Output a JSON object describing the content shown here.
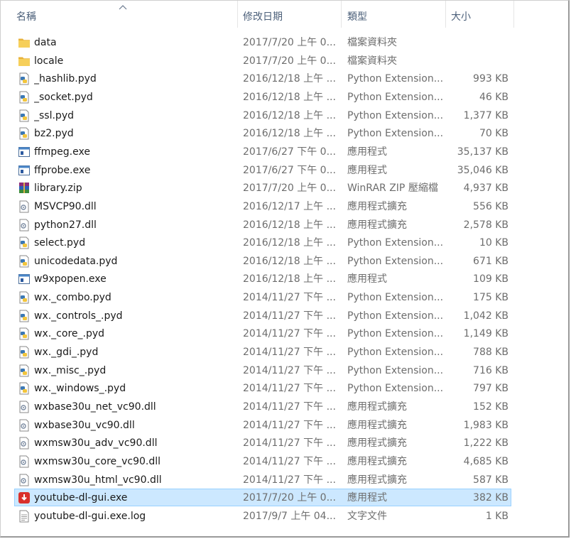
{
  "header": {
    "name": "名稱",
    "date": "修改日期",
    "type": "類型",
    "size": "大小",
    "sort_icon": "chevron-up-icon"
  },
  "files": [
    {
      "name": "data",
      "date": "2017/7/20 上午 0...",
      "type": "檔案資料夾",
      "size": "",
      "icon": "folder-icon"
    },
    {
      "name": "locale",
      "date": "2017/7/20 上午 0...",
      "type": "檔案資料夾",
      "size": "",
      "icon": "folder-icon"
    },
    {
      "name": "_hashlib.pyd",
      "date": "2016/12/18 上午 ...",
      "type": "Python Extension...",
      "size": "993 KB",
      "icon": "python-file-icon"
    },
    {
      "name": "_socket.pyd",
      "date": "2016/12/18 上午 ...",
      "type": "Python Extension...",
      "size": "46 KB",
      "icon": "python-file-icon"
    },
    {
      "name": "_ssl.pyd",
      "date": "2016/12/18 上午 ...",
      "type": "Python Extension...",
      "size": "1,377 KB",
      "icon": "python-file-icon"
    },
    {
      "name": "bz2.pyd",
      "date": "2016/12/18 上午 ...",
      "type": "Python Extension...",
      "size": "70 KB",
      "icon": "python-file-icon"
    },
    {
      "name": "ffmpeg.exe",
      "date": "2017/6/27 下午 0...",
      "type": "應用程式",
      "size": "35,137 KB",
      "icon": "exe-icon"
    },
    {
      "name": "ffprobe.exe",
      "date": "2017/6/27 下午 0...",
      "type": "應用程式",
      "size": "35,046 KB",
      "icon": "exe-icon"
    },
    {
      "name": "library.zip",
      "date": "2017/7/20 上午 0...",
      "type": "WinRAR ZIP 壓縮檔",
      "size": "4,937 KB",
      "icon": "winrar-icon"
    },
    {
      "name": "MSVCP90.dll",
      "date": "2016/12/17 上午 ...",
      "type": "應用程式擴充",
      "size": "556 KB",
      "icon": "dll-icon"
    },
    {
      "name": "python27.dll",
      "date": "2016/12/18 上午 ...",
      "type": "應用程式擴充",
      "size": "2,578 KB",
      "icon": "dll-icon"
    },
    {
      "name": "select.pyd",
      "date": "2016/12/18 上午 ...",
      "type": "Python Extension...",
      "size": "10 KB",
      "icon": "python-file-icon"
    },
    {
      "name": "unicodedata.pyd",
      "date": "2016/12/18 上午 ...",
      "type": "Python Extension...",
      "size": "671 KB",
      "icon": "python-file-icon"
    },
    {
      "name": "w9xpopen.exe",
      "date": "2016/12/18 上午 ...",
      "type": "應用程式",
      "size": "109 KB",
      "icon": "exe-icon"
    },
    {
      "name": "wx._combo.pyd",
      "date": "2014/11/27 下午 ...",
      "type": "Python Extension...",
      "size": "175 KB",
      "icon": "python-file-icon"
    },
    {
      "name": "wx._controls_.pyd",
      "date": "2014/11/27 下午 ...",
      "type": "Python Extension...",
      "size": "1,042 KB",
      "icon": "python-file-icon"
    },
    {
      "name": "wx._core_.pyd",
      "date": "2014/11/27 下午 ...",
      "type": "Python Extension...",
      "size": "1,149 KB",
      "icon": "python-file-icon"
    },
    {
      "name": "wx._gdi_.pyd",
      "date": "2014/11/27 下午 ...",
      "type": "Python Extension...",
      "size": "788 KB",
      "icon": "python-file-icon"
    },
    {
      "name": "wx._misc_.pyd",
      "date": "2014/11/27 下午 ...",
      "type": "Python Extension...",
      "size": "716 KB",
      "icon": "python-file-icon"
    },
    {
      "name": "wx._windows_.pyd",
      "date": "2014/11/27 下午 ...",
      "type": "Python Extension...",
      "size": "797 KB",
      "icon": "python-file-icon"
    },
    {
      "name": "wxbase30u_net_vc90.dll",
      "date": "2014/11/27 下午 ...",
      "type": "應用程式擴充",
      "size": "152 KB",
      "icon": "dll-icon"
    },
    {
      "name": "wxbase30u_vc90.dll",
      "date": "2014/11/27 下午 ...",
      "type": "應用程式擴充",
      "size": "1,983 KB",
      "icon": "dll-icon"
    },
    {
      "name": "wxmsw30u_adv_vc90.dll",
      "date": "2014/11/27 下午 ...",
      "type": "應用程式擴充",
      "size": "1,222 KB",
      "icon": "dll-icon"
    },
    {
      "name": "wxmsw30u_core_vc90.dll",
      "date": "2014/11/27 下午 ...",
      "type": "應用程式擴充",
      "size": "4,685 KB",
      "icon": "dll-icon"
    },
    {
      "name": "wxmsw30u_html_vc90.dll",
      "date": "2014/11/27 下午 ...",
      "type": "應用程式擴充",
      "size": "587 KB",
      "icon": "dll-icon"
    },
    {
      "name": "youtube-dl-gui.exe",
      "date": "2017/7/20 上午 0...",
      "type": "應用程式",
      "size": "382 KB",
      "icon": "youtube-dl-gui-icon",
      "selected": true
    },
    {
      "name": "youtube-dl-gui.exe.log",
      "date": "2017/9/7 上午 04...",
      "type": "文字文件",
      "size": "1 KB",
      "icon": "text-file-icon"
    }
  ]
}
